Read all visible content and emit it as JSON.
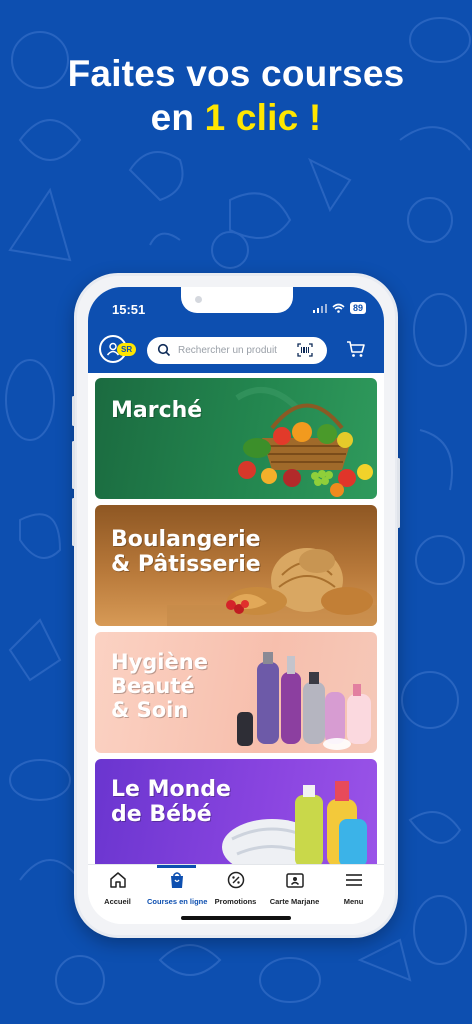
{
  "promo": {
    "headline_line1": "Faites vos courses",
    "headline_line2_prefix": "en ",
    "headline_line2_highlight": "1 clic !"
  },
  "status_bar": {
    "time": "15:51",
    "battery": "89"
  },
  "header": {
    "avatar_badge": "SR",
    "search_placeholder": "Rechercher un produit"
  },
  "categories": [
    {
      "title": "Marché",
      "color": "#1f7a4a"
    },
    {
      "title": "Boulangerie\n& Pâtisserie",
      "color": "#a9682c"
    },
    {
      "title": "Hygiène\nBeauté\n& Soin",
      "color": "#f3b7a6"
    },
    {
      "title": "Le Monde\nde Bébé",
      "color": "#7c3fd6"
    }
  ],
  "bottom_nav": [
    {
      "label": "Accueil",
      "icon": "home-icon",
      "active": false
    },
    {
      "label": "Courses en ligne",
      "icon": "shopping-bag-icon",
      "active": true
    },
    {
      "label": "Promotions",
      "icon": "percent-badge-icon",
      "active": false
    },
    {
      "label": "Carte Marjane",
      "icon": "loyalty-card-icon",
      "active": false
    },
    {
      "label": "Menu",
      "icon": "hamburger-menu-icon",
      "active": false
    }
  ],
  "colors": {
    "brand_blue": "#0d4fb0",
    "accent_yellow": "#ffe600"
  }
}
